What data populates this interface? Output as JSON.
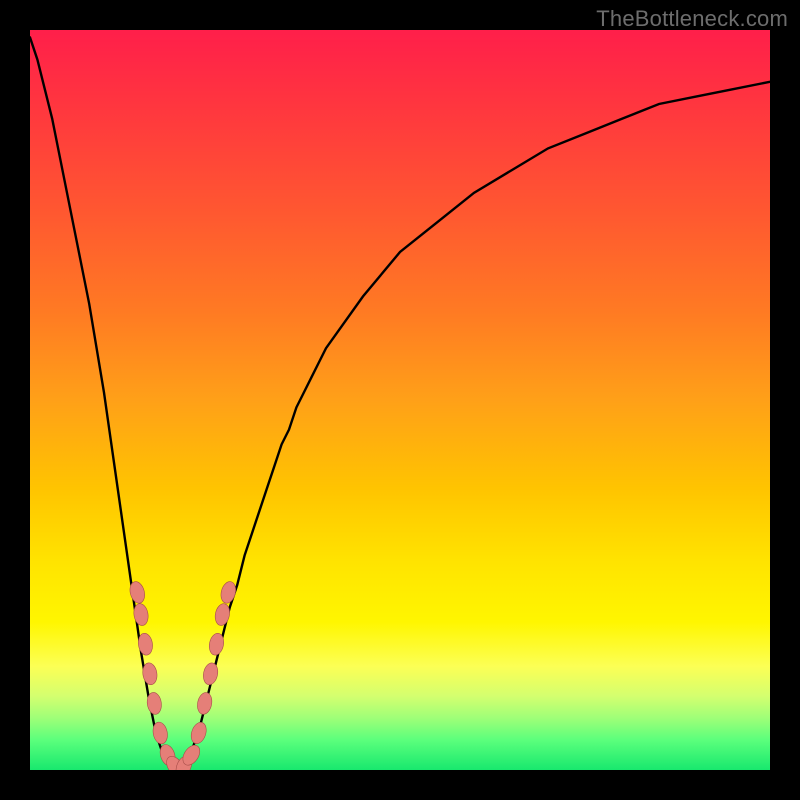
{
  "watermark": "TheBottleneck.com",
  "bead_color": "#e57f78",
  "bead_stroke": "#a74e49",
  "curve_color": "#000000",
  "chart_data": {
    "type": "line",
    "title": "",
    "xlabel": "",
    "ylabel": "",
    "ylim": [
      0,
      100
    ],
    "xlim": [
      0,
      100
    ],
    "x": [
      0,
      1,
      2,
      3,
      4,
      5,
      6,
      7,
      8,
      9,
      10,
      11,
      12,
      13,
      14,
      15,
      16,
      17,
      18,
      19,
      20,
      21,
      22,
      23,
      24,
      25,
      26,
      27,
      28,
      29,
      30,
      31,
      32,
      33,
      34,
      35,
      36,
      37,
      38,
      39,
      40,
      45,
      50,
      55,
      60,
      65,
      70,
      75,
      80,
      85,
      90,
      95,
      100
    ],
    "series": [
      {
        "name": "bottleneck_pct",
        "values": [
          99,
          96,
          92,
          88,
          83,
          78,
          73,
          68,
          63,
          57,
          51,
          44,
          37,
          30,
          23,
          16,
          10,
          5,
          2,
          0,
          0,
          1,
          3,
          6,
          10,
          14,
          18,
          22,
          25,
          29,
          32,
          35,
          38,
          41,
          44,
          46,
          49,
          51,
          53,
          55,
          57,
          64,
          70,
          74,
          78,
          81,
          84,
          86,
          88,
          90,
          91,
          92,
          93
        ]
      }
    ],
    "markers_left": [
      {
        "x": 14.5,
        "y": 24
      },
      {
        "x": 15.0,
        "y": 21
      },
      {
        "x": 15.6,
        "y": 17
      },
      {
        "x": 16.2,
        "y": 13
      },
      {
        "x": 16.8,
        "y": 9
      },
      {
        "x": 17.6,
        "y": 5
      },
      {
        "x": 18.6,
        "y": 2
      },
      {
        "x": 19.6,
        "y": 0.5
      }
    ],
    "markers_right": [
      {
        "x": 20.8,
        "y": 0.5
      },
      {
        "x": 21.8,
        "y": 2
      },
      {
        "x": 22.8,
        "y": 5
      },
      {
        "x": 23.6,
        "y": 9
      },
      {
        "x": 24.4,
        "y": 13
      },
      {
        "x": 25.2,
        "y": 17
      },
      {
        "x": 26.0,
        "y": 21
      },
      {
        "x": 26.8,
        "y": 24
      }
    ]
  }
}
